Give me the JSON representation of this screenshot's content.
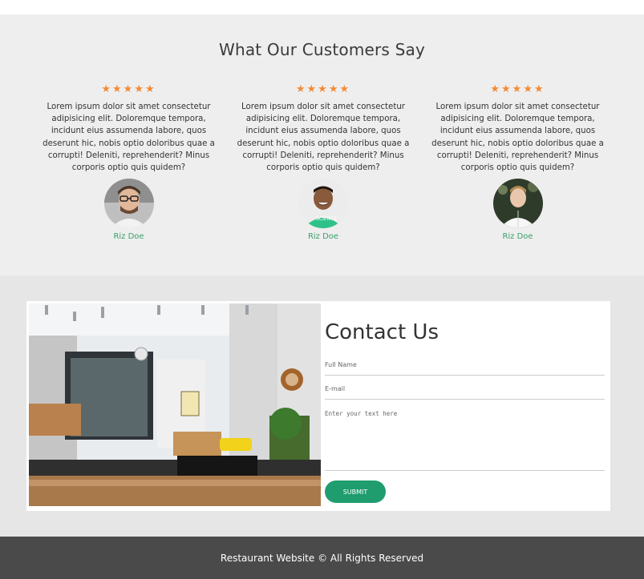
{
  "testimonials": {
    "heading": "What Our Customers Say",
    "items": [
      {
        "stars": "★★★★★",
        "text": "Lorem ipsum dolor sit amet consectetur adipisicing elit. Doloremque tempora, incidunt eius assumenda labore, quos deserunt hic, nobis optio doloribus quae a corrupti! Deleniti, reprehenderit? Minus corporis optio quis quidem?",
        "name": "Riz Doe"
      },
      {
        "stars": "★★★★★",
        "text": "Lorem ipsum dolor sit amet consectetur adipisicing elit. Doloremque tempora, incidunt eius assumenda labore, quos deserunt hic, nobis optio doloribus quae a corrupti! Deleniti, reprehenderit? Minus corporis optio quis quidem?",
        "name": "Riz Doe"
      },
      {
        "stars": "★★★★★",
        "text": "Lorem ipsum dolor sit amet consectetur adipisicing elit. Doloremque tempora, incidunt eius assumenda labore, quos deserunt hic, nobis optio doloribus quae a corrupti! Deleniti, reprehenderit? Minus corporis optio quis quidem?",
        "name": "Riz Doe"
      }
    ]
  },
  "contact": {
    "title": "Contact Us",
    "full_name_placeholder": "Full Name",
    "email_placeholder": "E-mail",
    "message_placeholder": "Enter your text here",
    "submit_label": "SUBMIT"
  },
  "footer": {
    "text": "Restaurant Website © All Rights Reserved"
  },
  "colors": {
    "star": "#f58a34",
    "name": "#3aa06b",
    "submit": "#1f9d6f",
    "footer_bg": "#4a4a4a"
  }
}
